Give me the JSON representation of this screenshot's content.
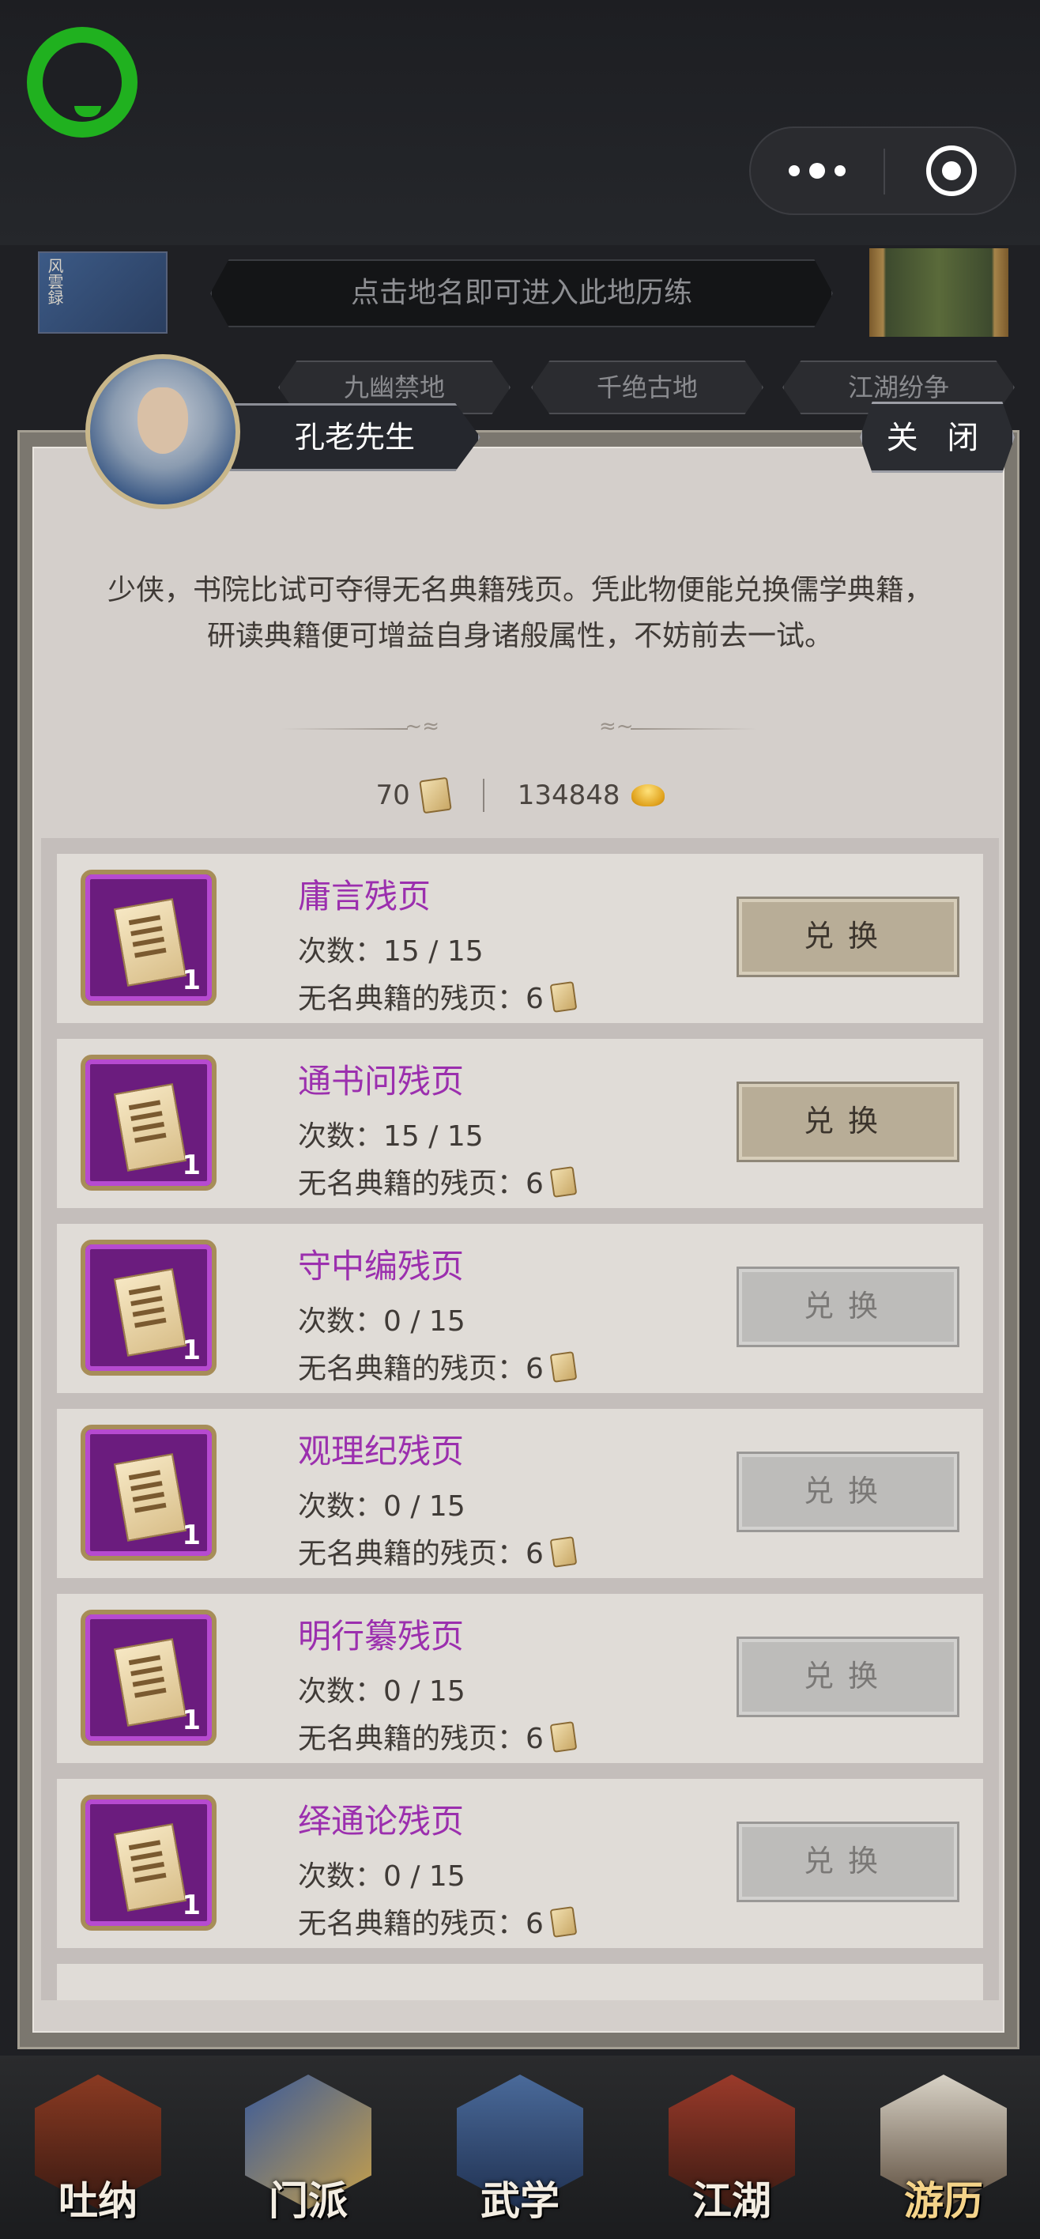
{
  "header": {
    "hint": "点击地名即可进入此地历练",
    "tabs": [
      "九幽禁地",
      "千绝古地",
      "江湖纷争"
    ]
  },
  "dialog": {
    "npc_name": "孔老先生",
    "close_label": "关 闭",
    "intro": "少侠，书院比试可夺得无名典籍残页。凭此物便能兑换儒学典籍，研读典籍便可增益自身诸般属性，不妨前去一试。",
    "currency": {
      "pages": "70",
      "gold": "134848"
    },
    "items": [
      {
        "name": "庸言残页",
        "times": "次数：15 / 15",
        "cost": "无名典籍的残页：6",
        "count": "1",
        "button": "兑换",
        "enabled": true
      },
      {
        "name": "通书问残页",
        "times": "次数：15 / 15",
        "cost": "无名典籍的残页：6",
        "count": "1",
        "button": "兑换",
        "enabled": true
      },
      {
        "name": "守中编残页",
        "times": "次数：0 / 15",
        "cost": "无名典籍的残页：6",
        "count": "1",
        "button": "兑换",
        "enabled": false
      },
      {
        "name": "观理纪残页",
        "times": "次数：0 / 15",
        "cost": "无名典籍的残页：6",
        "count": "1",
        "button": "兑换",
        "enabled": false
      },
      {
        "name": "明行纂残页",
        "times": "次数：0 / 15",
        "cost": "无名典籍的残页：6",
        "count": "1",
        "button": "兑换",
        "enabled": false
      },
      {
        "name": "绎通论残页",
        "times": "次数：0 / 15",
        "cost": "无名典籍的残页：6",
        "count": "1",
        "button": "兑换",
        "enabled": false
      }
    ]
  },
  "bottom_nav": [
    {
      "label": "吐纳",
      "active": false
    },
    {
      "label": "门派",
      "active": false
    },
    {
      "label": "武学",
      "active": false
    },
    {
      "label": "江湖",
      "active": false
    },
    {
      "label": "游历",
      "active": true
    }
  ],
  "colors": {
    "item_name": "#9b2fae",
    "enabled_button": "#b8ad97",
    "disabled_button": "#bdbcba",
    "app_logo": "#20b11f"
  }
}
